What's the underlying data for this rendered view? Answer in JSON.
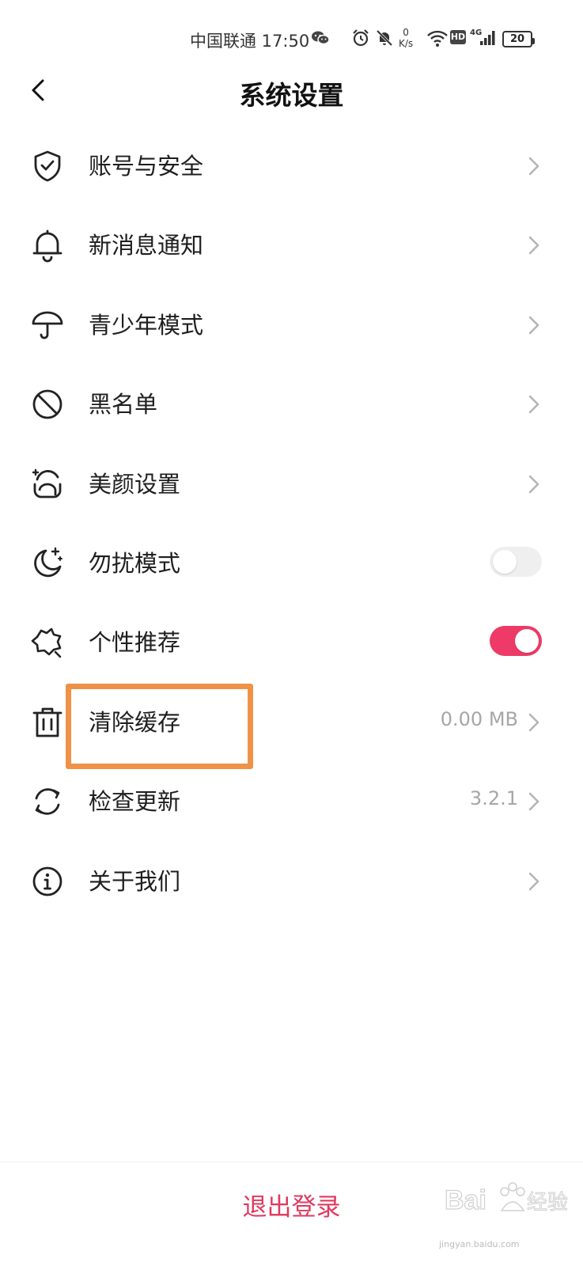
{
  "status_bar": {
    "carrier_time": "中国联通 17:50",
    "net_speed_value": "0",
    "net_speed_unit": "K/s",
    "hd_badge": "HD",
    "network_type": "4G",
    "battery_level": "20"
  },
  "header": {
    "title": "系统设置",
    "back_icon": "chevron-left-icon"
  },
  "settings": {
    "items": [
      {
        "label": "账号与安全",
        "icon": "shield-check-icon",
        "control": "chevron"
      },
      {
        "label": "新消息通知",
        "icon": "bell-icon",
        "control": "chevron"
      },
      {
        "label": "青少年模式",
        "icon": "umbrella-icon",
        "control": "chevron"
      },
      {
        "label": "黑名单",
        "icon": "block-icon",
        "control": "chevron"
      },
      {
        "label": "美颜设置",
        "icon": "face-sparkle-icon",
        "control": "chevron"
      },
      {
        "label": "勿扰模式",
        "icon": "moon-stars-icon",
        "control": "toggle",
        "toggle_on": false
      },
      {
        "label": "个性推荐",
        "icon": "star-badge-icon",
        "control": "toggle",
        "toggle_on": true
      },
      {
        "label": "清除缓存",
        "icon": "trash-icon",
        "control": "chevron",
        "value": "0.00 MB"
      },
      {
        "label": "检查更新",
        "icon": "refresh-icon",
        "control": "chevron",
        "value": "3.2.1"
      },
      {
        "label": "关于我们",
        "icon": "info-circle-icon",
        "control": "chevron"
      }
    ]
  },
  "footer": {
    "logout_label": "退出登录"
  },
  "colors": {
    "accent": "#e0395f",
    "toggle_on": "#ee3a66",
    "toggle_off": "#efefef",
    "highlight_box": "#ef9248",
    "value_text": "#a6a6a6"
  },
  "watermark": {
    "logo_text": "Baidu经验",
    "url": "jingyan.baidu.com"
  }
}
